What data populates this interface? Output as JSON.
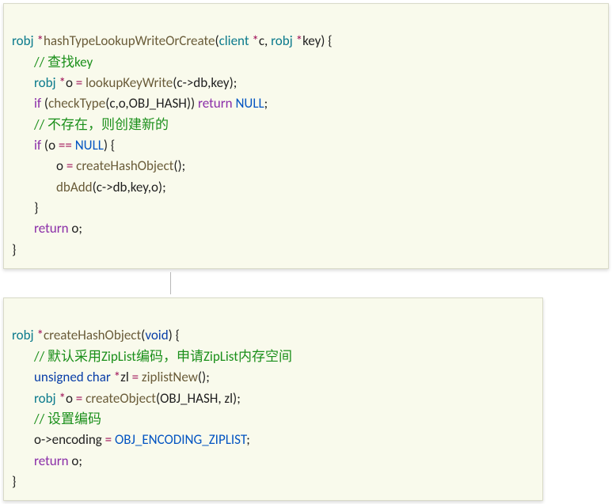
{
  "block1": {
    "l1": {
      "ty": "robj",
      "op1": "*",
      "fn": "hashTypeLookupWriteOrCreate",
      "p1": "(",
      "ty2": "client",
      "op2": " *",
      "a1": "c",
      "c1": ", ",
      "ty3": "robj",
      "op3": " *",
      "a2": "key",
      "p2": ") {"
    },
    "l2": {
      "cm": "// 查找key"
    },
    "l3": {
      "ty": "robj",
      "op1": " *",
      "v": "o",
      "eq": " = ",
      "fn": "lookupKeyWrite",
      "args": "(c->db,key);"
    },
    "l4": {
      "kw": "if",
      "p": " (",
      "fn": "checkType",
      "args": "(c,o,OBJ_HASH)) ",
      "ret": "return",
      "sp": " ",
      "nul": "NULL",
      "semi": ";"
    },
    "l5": {
      "cm": "// 不存在，则创建新的"
    },
    "l6": {
      "kw": "if",
      "p": " (o ",
      "op": "==",
      "sp": " ",
      "nul": "NULL",
      "p2": ") {"
    },
    "l7": {
      "lhs": "o ",
      "eq": "= ",
      "fn": "createHashObject",
      "tail": "();"
    },
    "l8": {
      "fn": "dbAdd",
      "args": "(c->db,key,o);"
    },
    "l9": {
      "brace": "}"
    },
    "l10": {
      "ret": "return",
      "sp": " o;"
    },
    "l11": {
      "brace": "}"
    }
  },
  "block2": {
    "l1": {
      "ty": "robj",
      "op1": " *",
      "fn": "createHashObject",
      "p1": "(",
      "kw": "void",
      "p2": ") {"
    },
    "l2": {
      "cm": "// 默认采用ZipList编码，申请ZipList内存空间"
    },
    "l3": {
      "kw": "unsigned",
      "sp": " ",
      "kw2": "char",
      "op": " *",
      "v": "zl ",
      "eq": "= ",
      "fn": "ziplistNew",
      "tail": "();"
    },
    "l4": {
      "ty": "robj",
      "op": " *",
      "v": "o ",
      "eq": "= ",
      "fn": "createObject",
      "args": "(OBJ_HASH, zl);"
    },
    "l5": {
      "cm": "// 设置编码"
    },
    "l6": {
      "lhs": "o->encoding ",
      "eq": "= ",
      "const": "OBJ_ENCODING_ZIPLIST",
      "semi": ";"
    },
    "l7": {
      "ret": "return",
      "sp": " o;"
    },
    "l8": {
      "brace": "}"
    }
  }
}
